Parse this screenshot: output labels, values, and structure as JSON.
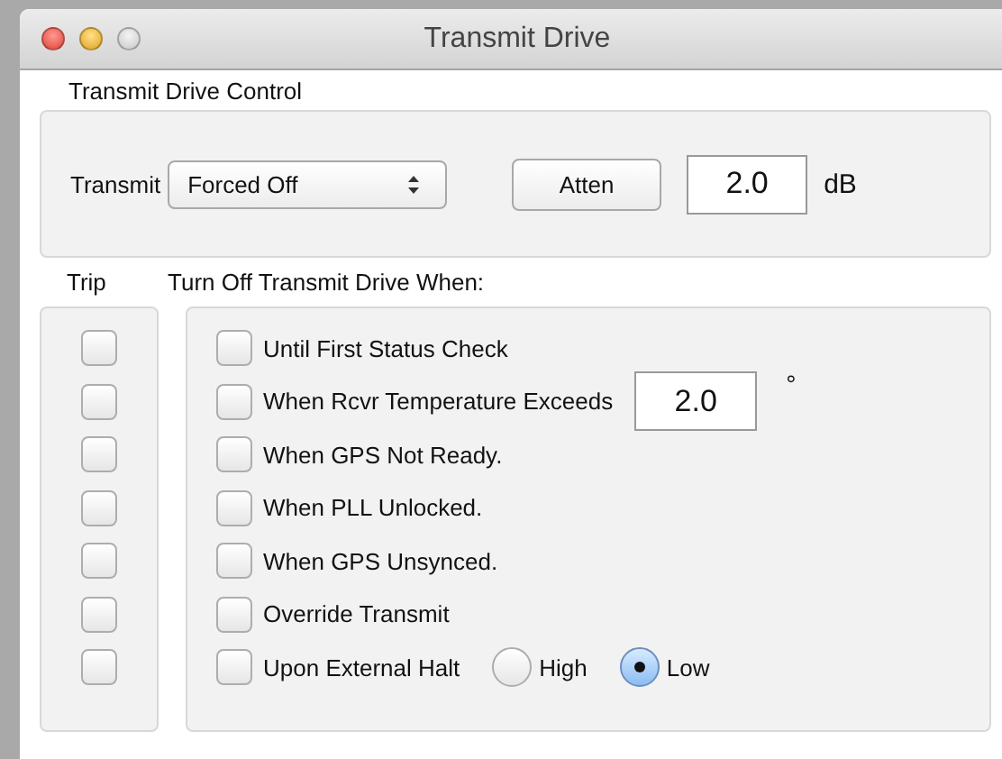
{
  "window": {
    "title": "Transmit Drive"
  },
  "control": {
    "title": "Transmit Drive Control",
    "transmit_label": "Transmit",
    "transmit_value": "Forced Off",
    "atten_button": "Atten",
    "atten_value": "2.0",
    "atten_unit": "dB"
  },
  "trip": {
    "title": "Trip",
    "checkboxes": [
      {
        "checked": false
      },
      {
        "checked": false
      },
      {
        "checked": false
      },
      {
        "checked": false
      },
      {
        "checked": false
      },
      {
        "checked": false
      },
      {
        "checked": false
      }
    ]
  },
  "conditions": {
    "title": "Turn Off Transmit Drive When:",
    "items": [
      {
        "kind": "checkbox",
        "label": "Until First Status Check",
        "checked": false
      },
      {
        "kind": "threshold",
        "label": "When Rcvr Temperature Exceeds",
        "checked": false,
        "value": "2.0",
        "unit": "°"
      },
      {
        "kind": "checkbox",
        "label": "When GPS Not Ready.",
        "checked": false
      },
      {
        "kind": "checkbox",
        "label": "When PLL Unlocked.",
        "checked": false
      },
      {
        "kind": "checkbox",
        "label": "When GPS Unsynced.",
        "checked": false
      },
      {
        "kind": "checkbox",
        "label": "Override Transmit",
        "checked": false
      },
      {
        "kind": "radios",
        "label": "Upon External Halt",
        "checked": false,
        "options": [
          {
            "label": "High",
            "selected": false
          },
          {
            "label": "Low",
            "selected": true
          }
        ]
      }
    ]
  }
}
